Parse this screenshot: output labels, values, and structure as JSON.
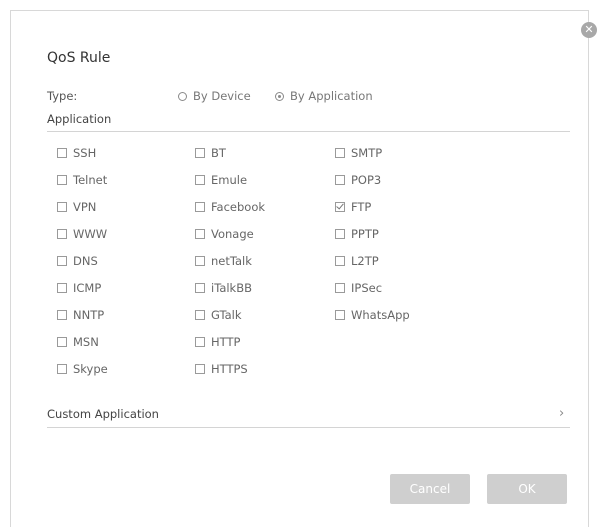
{
  "dialog": {
    "title": "QoS Rule",
    "close_icon": "close-icon"
  },
  "type": {
    "label": "Type:",
    "options": [
      {
        "label": "By Device",
        "selected": false
      },
      {
        "label": "By Application",
        "selected": true
      }
    ]
  },
  "application": {
    "label": "Application",
    "columns": [
      [
        {
          "label": "SSH",
          "checked": false
        },
        {
          "label": "Telnet",
          "checked": false
        },
        {
          "label": "VPN",
          "checked": false
        },
        {
          "label": "WWW",
          "checked": false
        },
        {
          "label": "DNS",
          "checked": false
        },
        {
          "label": "ICMP",
          "checked": false
        },
        {
          "label": "NNTP",
          "checked": false
        },
        {
          "label": "MSN",
          "checked": false
        },
        {
          "label": "Skype",
          "checked": false
        }
      ],
      [
        {
          "label": "BT",
          "checked": false
        },
        {
          "label": "Emule",
          "checked": false
        },
        {
          "label": "Facebook",
          "checked": false
        },
        {
          "label": "Vonage",
          "checked": false
        },
        {
          "label": "netTalk",
          "checked": false
        },
        {
          "label": "iTalkBB",
          "checked": false
        },
        {
          "label": "GTalk",
          "checked": false
        },
        {
          "label": "HTTP",
          "checked": false
        },
        {
          "label": "HTTPS",
          "checked": false
        }
      ],
      [
        {
          "label": "SMTP",
          "checked": false
        },
        {
          "label": "POP3",
          "checked": false
        },
        {
          "label": "FTP",
          "checked": true
        },
        {
          "label": "PPTP",
          "checked": false
        },
        {
          "label": "L2TP",
          "checked": false
        },
        {
          "label": "IPSec",
          "checked": false
        },
        {
          "label": "WhatsApp",
          "checked": false
        }
      ]
    ]
  },
  "custom": {
    "label": "Custom Application",
    "chevron": "›"
  },
  "buttons": {
    "cancel": "Cancel",
    "ok": "OK"
  },
  "colors": {
    "button_bg": "#cfcfcf",
    "divider": "#d4d4d4"
  }
}
